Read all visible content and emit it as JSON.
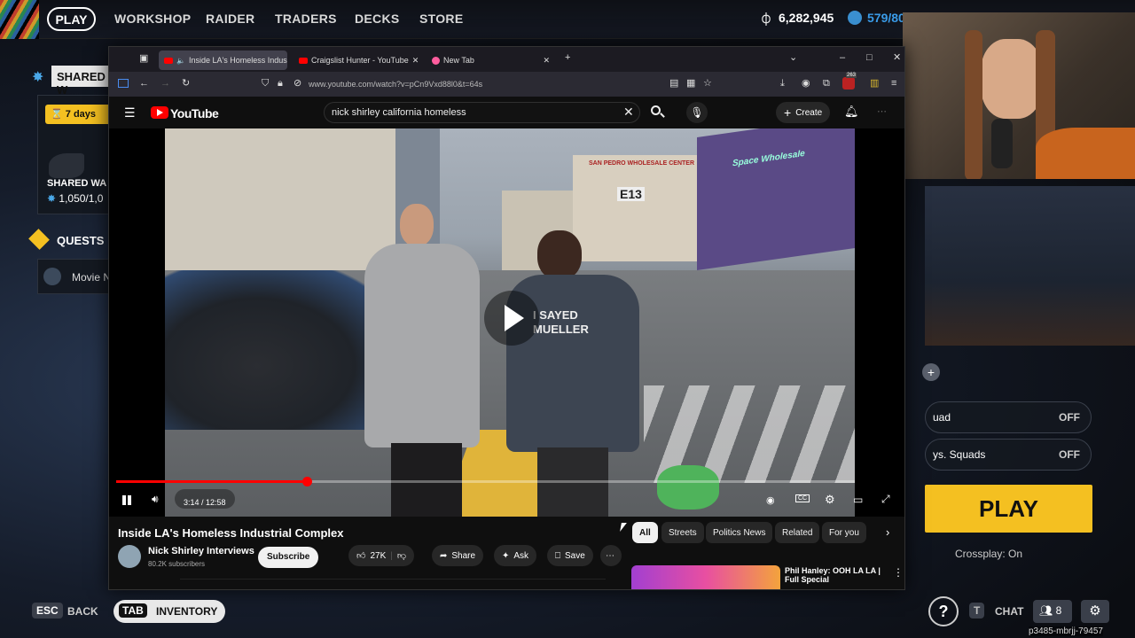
{
  "game": {
    "nav": [
      "PLAY",
      "WORKSHOP",
      "RAIDER",
      "TRADERS",
      "DECKS",
      "STORE"
    ],
    "coins": "6,282,945",
    "tokens": "579/80",
    "shared_label": "SHARED W",
    "days_label": "7 days",
    "shared_wa_label": "SHARED WA",
    "shared_progress": "1,050/1,0",
    "quests_label": "QUESTS",
    "quest_item": "Movie N",
    "options": [
      {
        "label": "uad",
        "value": "OFF"
      },
      {
        "label": "ys. Squads",
        "value": "OFF"
      }
    ],
    "play_button": "PLAY",
    "crossplay": "Crossplay: On",
    "bottom": {
      "esc_key": "ESC",
      "back": "BACK",
      "tab_key": "TAB",
      "inventory": "INVENTORY",
      "chat_key": "T",
      "chat": "CHAT",
      "friends_count": "8",
      "session_id": "p3485-mbrjj-79457"
    }
  },
  "browser": {
    "tabs": [
      {
        "title": "Inside LA's Homeless Indus",
        "active": true
      },
      {
        "title": "Craigslist Hunter - YouTube",
        "active": false
      },
      {
        "title": "New Tab",
        "active": false
      }
    ],
    "url": "www.youtube.com/watch?v=pCn9Vxd88l0&t=64s",
    "extension_badge": "263"
  },
  "youtube": {
    "logo": "YouTube",
    "search_value": "nick shirley california homeless",
    "create_label": "Create",
    "time": "3:14 / 12:58",
    "progress_fraction": 0.258,
    "video_title": "Inside LA's Homeless Industrial Complex",
    "channel": "Nick Shirley Interviews",
    "subscribers": "80.2K subscribers",
    "subscribe_label": "Subscribe",
    "likes": "27K",
    "share_label": "Share",
    "ask_label": "Ask",
    "save_label": "Save",
    "chips": [
      "All",
      "Streets",
      "Politics News",
      "Related",
      "For you"
    ],
    "rec_title_1": "Phil Hanley: OOH LA LA |",
    "rec_title_2": "Full Special",
    "video_overlay": {
      "shirt_line1": "I SAYED",
      "shirt_line2": "MUELLER",
      "sign_1": "SAN PEDRO WHOLESALE CENTER",
      "sign_2": "Space Wholesale",
      "sign_3": "E13"
    }
  }
}
